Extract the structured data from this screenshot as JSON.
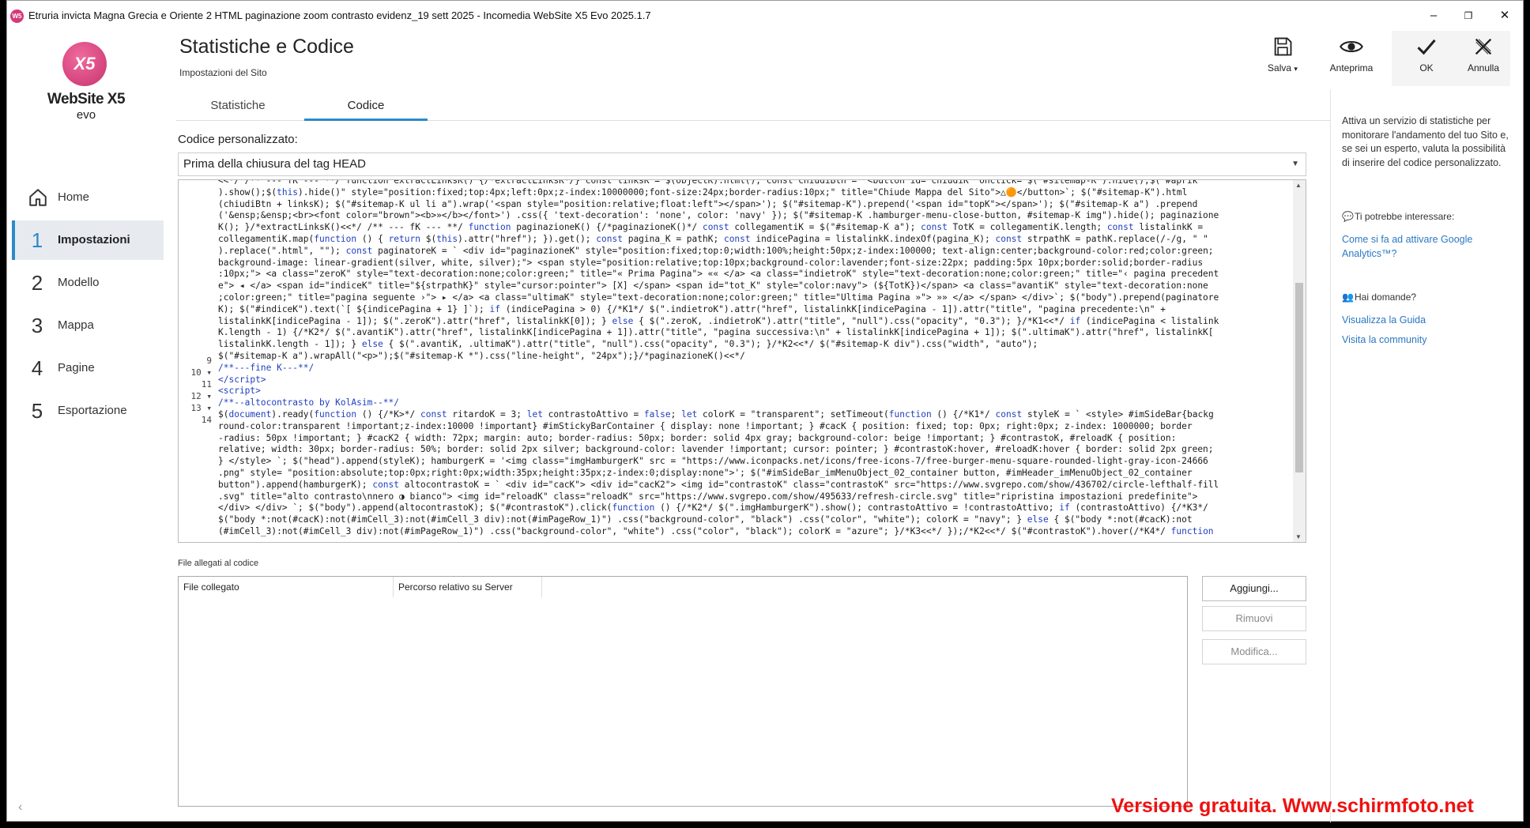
{
  "window": {
    "title": "Etruria invicta Magna Grecia e Oriente 2  HTML paginazione zoom contrasto evidenz_19 sett 2025 - Incomedia WebSite X5 Evo 2025.1.7",
    "controls": [
      "–",
      "❐",
      "✕"
    ]
  },
  "brand": {
    "name": "WebSite X5",
    "edition": "evo",
    "mark": "X5"
  },
  "nav": [
    {
      "num": "",
      "label": "Home"
    },
    {
      "num": "1",
      "label": "Impostazioni"
    },
    {
      "num": "2",
      "label": "Modello"
    },
    {
      "num": "3",
      "label": "Mappa"
    },
    {
      "num": "4",
      "label": "Pagine"
    },
    {
      "num": "5",
      "label": "Esportazione"
    }
  ],
  "header": {
    "title": "Statistiche e Codice",
    "subtitle": "Impostazioni del Sito"
  },
  "toolbar": {
    "save": "Salva",
    "save_caret": "▾",
    "preview": "Anteprima",
    "ok": "OK",
    "cancel": "Annulla"
  },
  "tabs": [
    "Statistiche",
    "Codice"
  ],
  "custom_code": {
    "label": "Codice personalizzato:",
    "position": "Prima della chiusura del tag HEAD",
    "line_numbers": [
      "9",
      "10",
      "11",
      "12",
      "13",
      "14"
    ]
  },
  "files": {
    "label": "File allegati al codice",
    "columns": [
      "File collegato",
      "Percorso relativo su Server"
    ],
    "buttons": {
      "add": "Aggiungi...",
      "remove": "Rimuovi",
      "edit": "Modifica..."
    }
  },
  "help": {
    "description": "Attiva un servizio di statistiche per monitorare l'andamento del tuo Sito e, se sei un esperto, valuta la possibilità di inserire del codice personalizzato.",
    "interest_title": "Ti potrebbe interessare:",
    "interest_link": "Come si fa ad attivare Google Analytics™?",
    "questions_title": "Hai domande?",
    "guide_link": "Visualizza la Guida",
    "community_link": "Visita la community"
  },
  "watermark": "Versione gratuita. Www.schirmfoto.net"
}
